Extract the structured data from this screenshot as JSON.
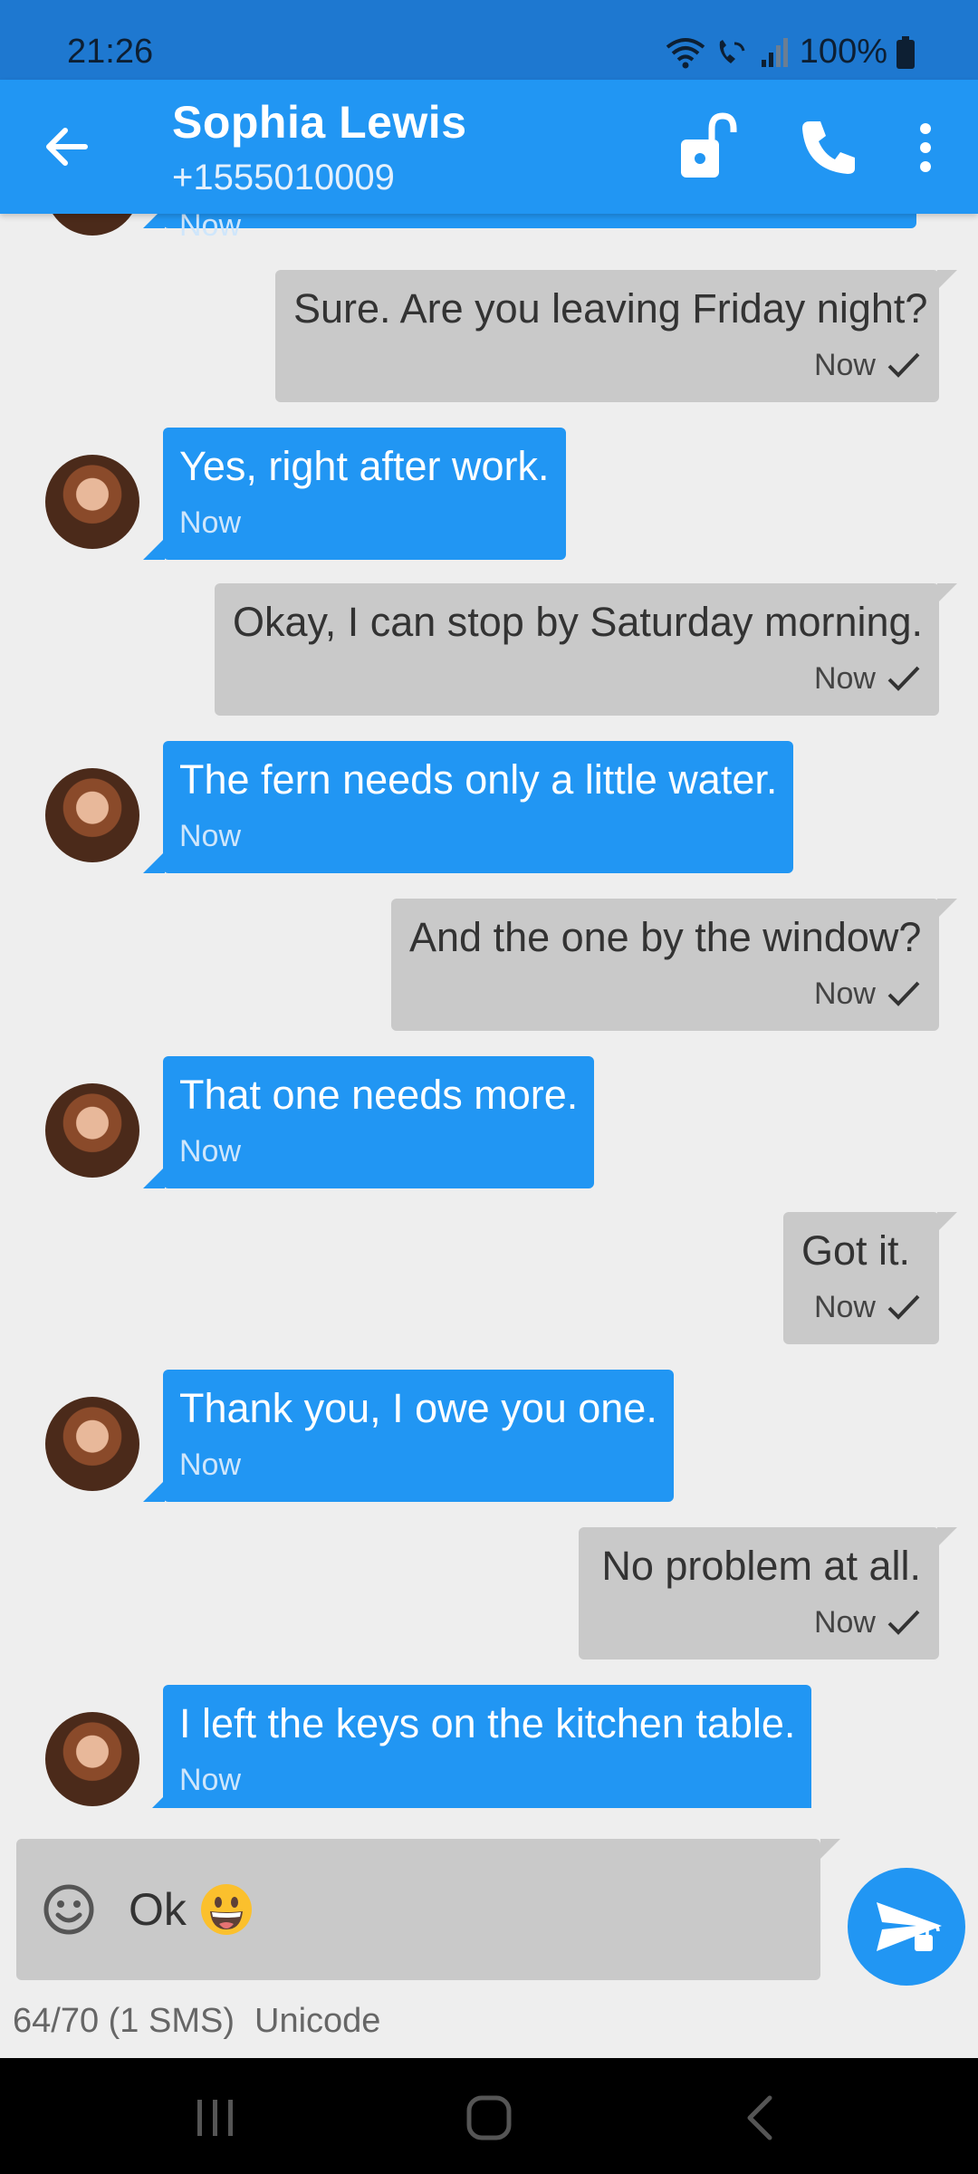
{
  "status_bar": {
    "time": "21:26",
    "battery": "100%"
  },
  "header": {
    "name": "Sophia Lewis",
    "number": "+1555010009"
  },
  "icons": {
    "back": "arrow-left-icon",
    "lock": "lock-open-icon",
    "call": "phone-icon",
    "more": "more-vertical-icon",
    "emoji": "smiley-icon",
    "send": "send-icon"
  },
  "messages": [
    {
      "dir": "in",
      "text": "",
      "time": "Now"
    },
    {
      "dir": "out",
      "text": "Sure. Are you leaving Friday night?",
      "time": "Now"
    },
    {
      "dir": "in",
      "text": "Yes, right after work.",
      "time": "Now"
    },
    {
      "dir": "out",
      "text": "Okay, I can stop by Saturday morning.",
      "time": "Now"
    },
    {
      "dir": "in",
      "text": "The fern needs only a little water.",
      "time": "Now"
    },
    {
      "dir": "out",
      "text": "And the one by the window?",
      "time": "Now"
    },
    {
      "dir": "in",
      "text": "That one needs more.",
      "time": "Now"
    },
    {
      "dir": "out",
      "text": "Got it.",
      "time": "Now"
    },
    {
      "dir": "in",
      "text": "Thank you, I owe you one.",
      "time": "Now"
    },
    {
      "dir": "out",
      "text": "No problem at all.",
      "time": "Now"
    },
    {
      "dir": "in",
      "text": "I left the keys on the kitchen table.",
      "time": "Now"
    }
  ],
  "compose": {
    "text": "Ok",
    "emoji": "😀"
  },
  "counter": {
    "count": "64/70 (1 SMS)",
    "encoding": "Unicode"
  },
  "colors": {
    "primary": "#2196f3",
    "status_bar": "#1e78d0",
    "outgoing": "#c9c9c9",
    "background": "#eeeeee"
  }
}
